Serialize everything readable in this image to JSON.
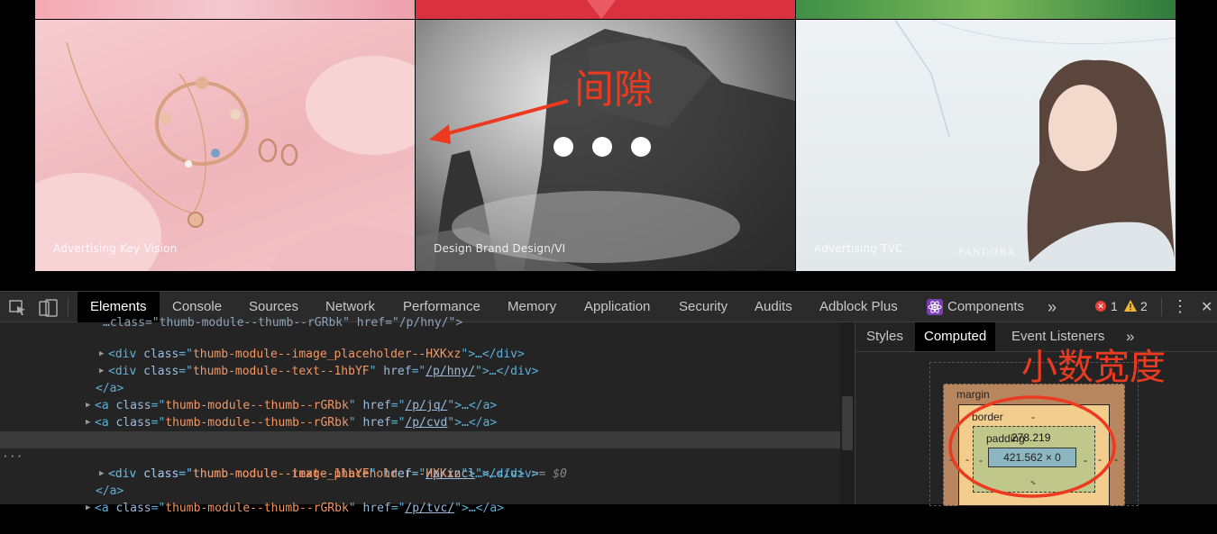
{
  "tiles": [
    {
      "label": "Advertising Key Vision"
    },
    {
      "label": "Design Brand Design/VI"
    },
    {
      "label": "Advertising TVC",
      "brand": "PANDORA"
    }
  ],
  "annotations": {
    "gap": "间隙",
    "decimal_width": "小数宽度",
    "color": "#ec3a21"
  },
  "devtools": {
    "tabs": [
      "Elements",
      "Console",
      "Sources",
      "Network",
      "Performance",
      "Memory",
      "Application",
      "Security",
      "Audits",
      "Adblock Plus",
      "Components"
    ],
    "active_tab": "Elements",
    "more": "»",
    "errors": "1",
    "warnings": "2",
    "kebab": "⋮",
    "close": "✕",
    "gutter_dots": "···",
    "eq_marker": "== $0",
    "side_tabs": [
      "Styles",
      "Computed",
      "Event Listeners"
    ],
    "side_more": "»",
    "code": [
      {
        "top": "…class=\"thumb-module--thumb--rGRbk\" href=\"/p/hny/\">"
      },
      {
        "cls": "thumb-module--image_placeholder--HXKxz",
        "tail": ">…</div>"
      },
      {
        "cls": "thumb-module--text--1hbYF",
        "href": "/p/hny/",
        "tail": ">…</div>"
      },
      {
        "close": "</a>"
      },
      {
        "cls": "thumb-module--thumb--rGRbk",
        "href": "/p/jq/",
        "tail": ">…</a>"
      },
      {
        "cls": "thumb-module--thumb--rGRbk",
        "href": "/p/cvd",
        "tail": ">…</a>"
      },
      {
        "cls": "thumb-module--thumb--rGRbk",
        "href": "/p/incl",
        "tail": ">"
      },
      {
        "cls": "thumb-module--image_placeholder--HXKxz",
        "tail": ">…</div>"
      },
      {
        "cls": "thumb-module--text--1hbYF",
        "href": "/p/incl",
        "tail": ">…</div>"
      },
      {
        "close": "</a>"
      },
      {
        "cls": "thumb-module--thumb--rGRbk",
        "href": "/p/tvc/",
        "tail": ">…</a>"
      }
    ],
    "box_model": {
      "margin_label": "margin",
      "border_label": "border",
      "padding_label": "padding",
      "dash": "-",
      "width_overlay": "278.219",
      "content": "421.562 × 0"
    }
  }
}
